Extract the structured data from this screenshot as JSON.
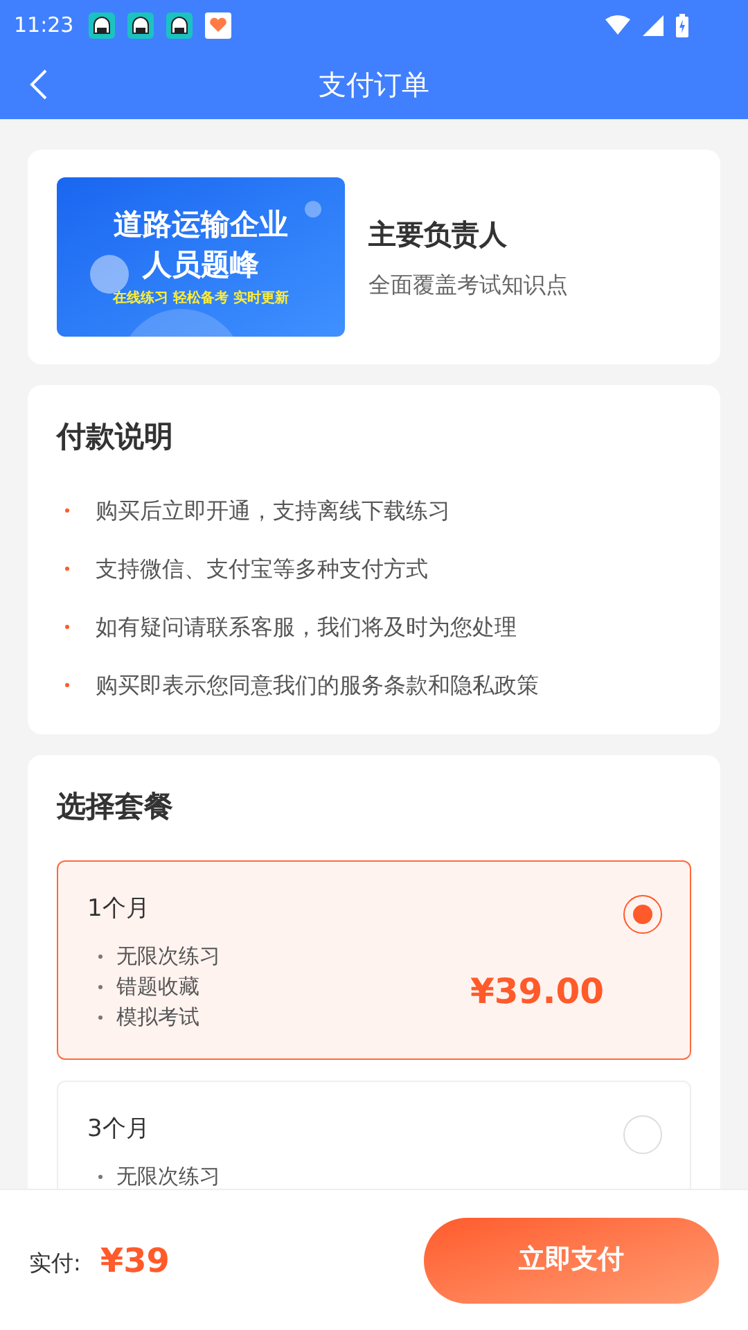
{
  "status_bar": {
    "time": "11:23"
  },
  "header": {
    "title": "支付订单"
  },
  "product": {
    "banner_title": "道路运输企业人员题峰",
    "banner_tagline": "在线练习 轻松备考 实时更新",
    "name": "主要负责人",
    "subtitle": "全面覆盖考试知识点"
  },
  "payment_notes": {
    "title": "付款说明",
    "items": [
      "购买后立即开通，支持离线下载练习",
      "支持微信、支付宝等多种支付方式",
      "如有疑问请联系客服，我们将及时为您处理",
      "购买即表示您同意我们的服务条款和隐私政策"
    ]
  },
  "plans": {
    "title": "选择套餐",
    "items": [
      {
        "name": "1个月",
        "features": [
          "无限次练习",
          "错题收藏",
          "模拟考试"
        ],
        "price": "¥39.00",
        "selected": true
      },
      {
        "name": "3个月",
        "features": [
          "无限次练习"
        ],
        "selected": false
      }
    ]
  },
  "footer": {
    "label": "实付:",
    "amount": "¥39",
    "button": "立即支付"
  }
}
